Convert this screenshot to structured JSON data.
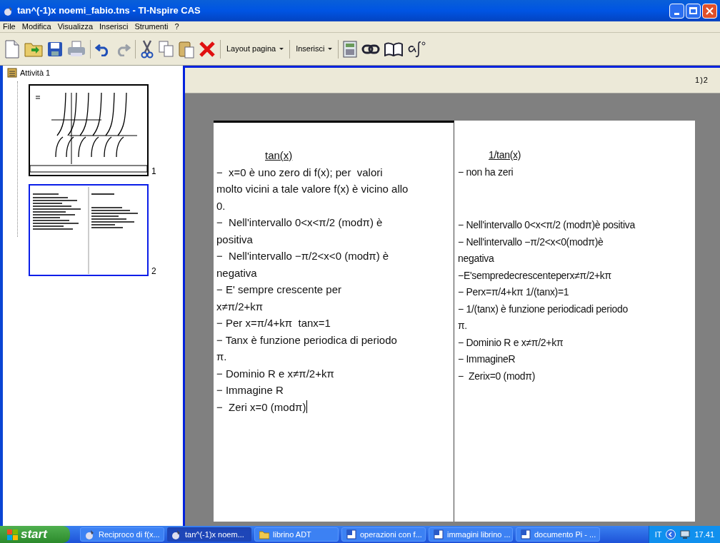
{
  "window": {
    "title": "tan^(-1)x noemi_fabio.tns - TI-Nspire CAS"
  },
  "menu": [
    "File",
    "Modifica",
    "Visualizza",
    "Inserisci",
    "Strumenti",
    "?"
  ],
  "toolbar": {
    "dropdowns": [
      "Layout pagina",
      "Inserisci"
    ]
  },
  "sidebar": {
    "problem": "Attività 1",
    "pages": [
      {
        "number": "1",
        "kind": "graph",
        "selected": false
      },
      {
        "number": "2",
        "kind": "notes",
        "selected": true
      }
    ]
  },
  "page_indicator": "1)2",
  "columns": [
    {
      "title": "tan(x)",
      "blocks": [
        {
          "lines": [
            "−  x=0 è uno zero di f(x); per  valori",
            "molto vicini a tale valore f(x) è vicino allo",
            "0.",
            "−  Nell'intervallo 0<x<π/2 (modπ) è",
            "positiva",
            "−  Nell'intervallo −π/2<x<0 (modπ) è",
            "negativa",
            "− E' sempre crescente per",
            "x≠π/2+kπ",
            "− Per x=π/4+kπ  tanx=1",
            "− Tanx è funzione periodica di periodo",
            "π.",
            "− Dominio R e x≠π/2+kπ",
            "− Immagine R",
            "−  Zeri x=0 (modπ)"
          ]
        }
      ],
      "cursor": true
    },
    {
      "title": "1/tan(x)",
      "blocks": [
        {
          "lines": [
            "− non ha zeri"
          ]
        },
        {
          "lines": [
            "− Nell'intervallo 0<x<π/2 (modπ)è positiva",
            "− Nell'intervallo −π/2<x<0(modπ)è",
            "negativa",
            "−E'sempredecrescenteperx≠π/2+kπ",
            "− Perx=π/4+kπ 1/(tanx)=1",
            "− 1/(tanx) è funzione periodicadi periodo",
            "π.",
            "− Dominio R e x≠π/2+kπ",
            "− ImmagineR",
            "−  Zerix=0 (modπ)"
          ]
        }
      ],
      "cursor": false
    }
  ],
  "taskbar": {
    "start": "start",
    "items": [
      {
        "label": "Reciproco di f(x...",
        "kind": "calc",
        "selected": false
      },
      {
        "label": "tan^(-1)x noem...",
        "kind": "calc",
        "selected": true
      },
      {
        "label": "librino ADT",
        "kind": "folder",
        "selected": false
      },
      {
        "label": "operazioni con f...",
        "kind": "doc",
        "selected": false
      },
      {
        "label": "immagini librino ...",
        "kind": "doc",
        "selected": false
      },
      {
        "label": "documento Pi - ...",
        "kind": "doc",
        "selected": false
      }
    ],
    "language": "IT",
    "clock": "17.41"
  }
}
